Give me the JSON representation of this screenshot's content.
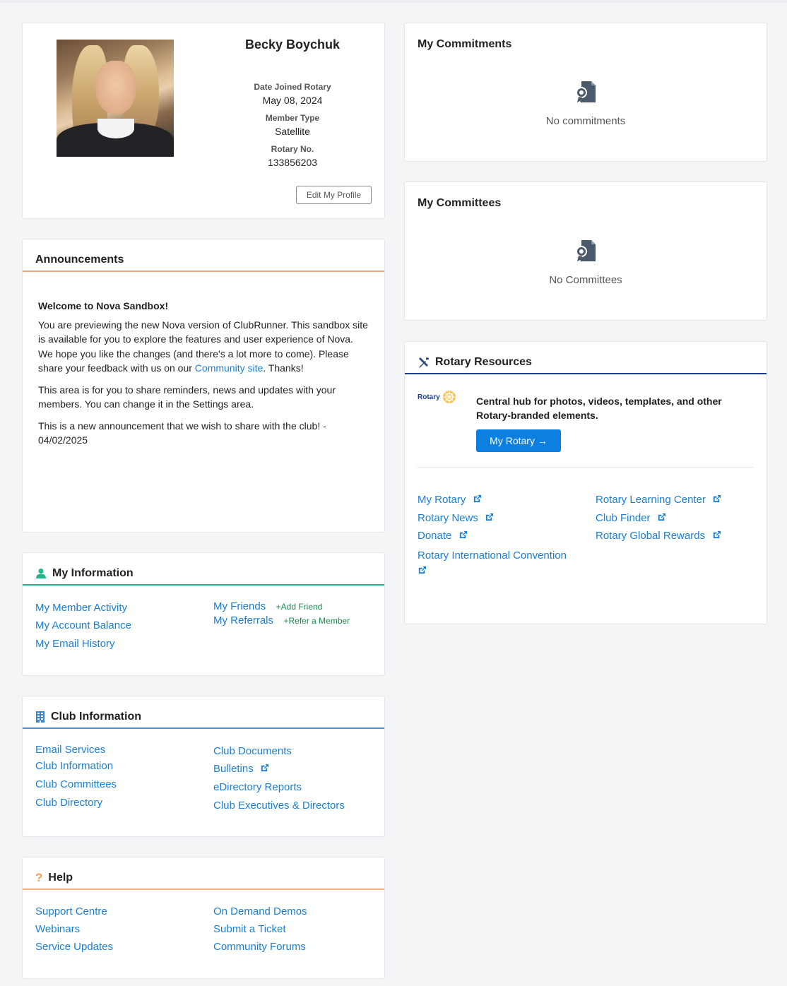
{
  "profile": {
    "name": "Becky Boychuk",
    "date_joined_label": "Date Joined Rotary",
    "date_joined": "May 08, 2024",
    "member_type_label": "Member Type",
    "member_type": "Satellite",
    "rotary_no_label": "Rotary No.",
    "rotary_no": "133856203",
    "edit_button": "Edit My Profile"
  },
  "announcements": {
    "title": "Announcements",
    "welcome": "Welcome to Nova Sandbox!",
    "para1": "You are previewing the new Nova version of ClubRunner. This sandbox site is available for you to explore the features and user experience of Nova. We hope you like the changes (and there's a lot more to come). Please share your feedback with us on our",
    "community_link": "Community site",
    "para1_end": ". Thanks!",
    "para2": "This area is for you to share reminders, news and updates with your members. You can change it in the Settings area.",
    "para3": "This is a new announcement that we wish to share with the club! - 04/02/2025"
  },
  "my_information": {
    "title": "My Information",
    "left_links": [
      "My Member Activity",
      "My Account Balance",
      "My Email History"
    ],
    "friends": "My Friends",
    "add_friend": "+Add Friend",
    "referrals": "My Referrals",
    "refer_member": "+Refer a Member"
  },
  "club_information": {
    "title": "Club Information",
    "left_links": [
      "Email Services",
      "Club Information",
      "Club Committees",
      "Club Directory"
    ],
    "right_links": [
      "Club Documents",
      "Bulletins",
      "eDirectory Reports",
      "Club Executives & Directors"
    ]
  },
  "help": {
    "title": "Help",
    "left_links": [
      "Support Centre",
      "Webinars",
      "Service Updates"
    ],
    "right_links": [
      "On Demand Demos",
      "Submit a Ticket",
      "Community Forums"
    ]
  },
  "commitments": {
    "title": "My Commitments",
    "empty_text": "No commitments"
  },
  "committees": {
    "title": "My Committees",
    "empty_text": "No Committees"
  },
  "rotary_resources": {
    "title": "Rotary Resources",
    "logo_text": "Rotary",
    "hub_text": "Central hub for photos, videos, templates, and other Rotary-branded elements.",
    "button_label": "My Rotary →",
    "left_links": [
      "My Rotary",
      "Rotary News",
      "Donate",
      "Rotary International Convention"
    ],
    "right_links": [
      "Rotary Learning Center",
      "Club Finder",
      "Rotary Global Rewards"
    ]
  },
  "colors": {
    "link": "#1a7fd4",
    "announcement_rule": "#f0a57e",
    "info_rule": "#1db989",
    "club_rule": "#4a90d9",
    "resources_rule": "#1d3f8a",
    "button_blue": "#0d7fe0"
  }
}
